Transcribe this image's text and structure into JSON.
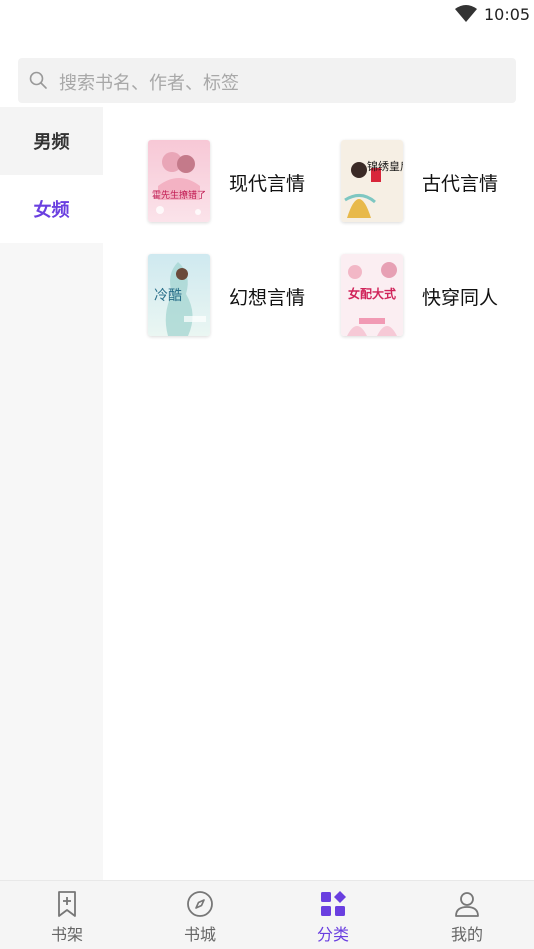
{
  "status_bar": {
    "time": "10:05"
  },
  "search": {
    "placeholder": "搜索书名、作者、标签"
  },
  "sidebar": {
    "items": [
      {
        "label": "男频",
        "active": false
      },
      {
        "label": "女频",
        "active": true
      }
    ]
  },
  "categories": [
    {
      "label": "现代言情",
      "cover_icon": "book-cover-modern-romance",
      "cover_text": "霍先生撩错了"
    },
    {
      "label": "古代言情",
      "cover_icon": "book-cover-ancient-romance",
      "cover_text": "锦绣皇后"
    },
    {
      "label": "幻想言情",
      "cover_icon": "book-cover-fantasy-romance",
      "cover_text": "冷酷"
    },
    {
      "label": "快穿同人",
      "cover_icon": "book-cover-fanfic",
      "cover_text": "女配大式"
    }
  ],
  "bottom_nav": {
    "items": [
      {
        "label": "书架",
        "icon": "bookmark-icon",
        "active": false
      },
      {
        "label": "书城",
        "icon": "compass-icon",
        "active": false
      },
      {
        "label": "分类",
        "icon": "category-grid-icon",
        "active": true
      },
      {
        "label": "我的",
        "icon": "person-icon",
        "active": false
      }
    ]
  },
  "colors": {
    "accent": "#6a3fe0",
    "sidebar_bg": "#f7f7f7",
    "search_bg": "#f2f2f2"
  }
}
